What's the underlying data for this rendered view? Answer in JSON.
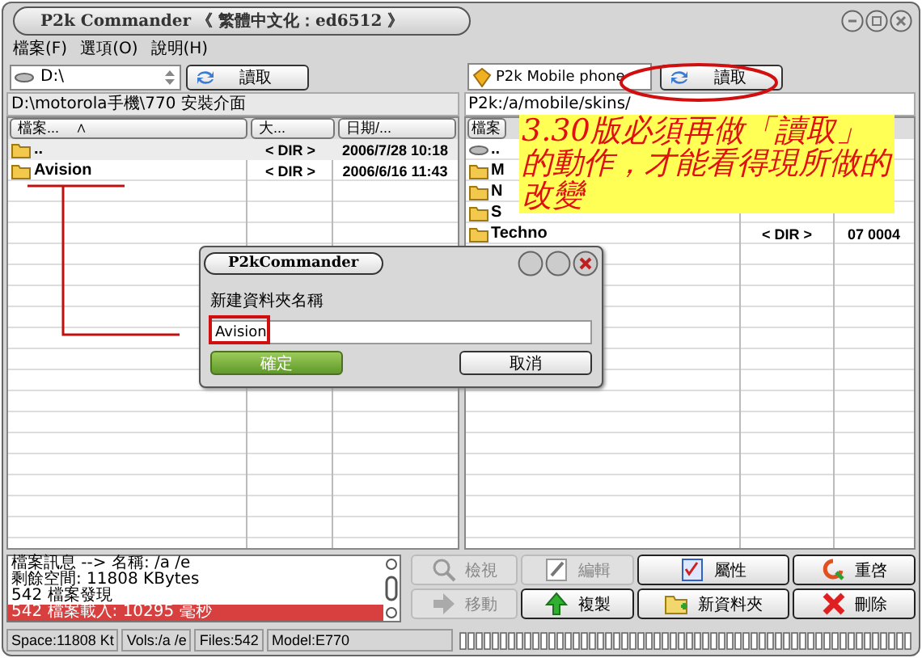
{
  "window": {
    "title": "P2k Commander 《 繁體中文化：ed6512 》"
  },
  "menu": [
    "檔案(F)",
    "選項(O)",
    "說明(H)"
  ],
  "left_panel": {
    "drive": "D:\\",
    "refresh_button": "讀取",
    "path": "D:\\motorola手機\\770 安裝介面",
    "columns": [
      "檔案...    ∧",
      "大...",
      "日期/..."
    ],
    "rows": [
      {
        "name": "..",
        "size": "< DIR >",
        "date": "2006/7/28 10:18",
        "selected": true
      },
      {
        "name": "Avision",
        "size": "< DIR >",
        "date": "2006/6/16 11:43",
        "selected": false
      }
    ]
  },
  "right_panel": {
    "device": "P2k Mobile phone",
    "refresh_button": "讀取",
    "path": "P2k:/a/mobile/skins/",
    "columns": [
      "檔案"
    ],
    "rows": [
      {
        "kind": "drive",
        "name": "..",
        "size": "",
        "date": ""
      },
      {
        "kind": "folder",
        "name": "M",
        "size": "",
        "date": ""
      },
      {
        "kind": "folder",
        "name": "N",
        "size": "",
        "date": ""
      },
      {
        "kind": "folder",
        "name": "S",
        "size": "",
        "date": ""
      },
      {
        "kind": "folder",
        "name": "Techno",
        "size": "< DIR >",
        "date": "07    0004"
      }
    ]
  },
  "annotation": "3.30版必須再做「讀取」的動作，才能看得現所做的改變",
  "dialog": {
    "title": "P2kCommander",
    "label": "新建資料夾名稱",
    "value": "Avision",
    "ok": "確定",
    "cancel": "取消"
  },
  "log": [
    {
      "text": "檔案訊息 --> 名稱: /a /e",
      "selected": false
    },
    {
      "text": "剩餘空間: 11808 KBytes",
      "selected": false
    },
    {
      "text": "542 檔案發現",
      "selected": false
    },
    {
      "text": "542 檔案載入: 10295 毫秒",
      "selected": true
    }
  ],
  "buttons": [
    {
      "kind": "view",
      "label": "檢視",
      "disabled": true
    },
    {
      "kind": "edit",
      "label": "編輯",
      "disabled": true
    },
    {
      "kind": "props",
      "label": "屬性",
      "disabled": false
    },
    {
      "kind": "restart",
      "label": "重啓",
      "disabled": false
    },
    {
      "kind": "move",
      "label": "移動",
      "disabled": true
    },
    {
      "kind": "copy",
      "label": "複製",
      "disabled": false
    },
    {
      "kind": "newfolder",
      "label": "新資料夾",
      "disabled": false
    },
    {
      "kind": "delete",
      "label": "刪除",
      "disabled": false
    }
  ],
  "status_bar": [
    "Space:11808 Kt",
    "Vols:/a /e",
    "Files:542",
    "Model:E770"
  ]
}
